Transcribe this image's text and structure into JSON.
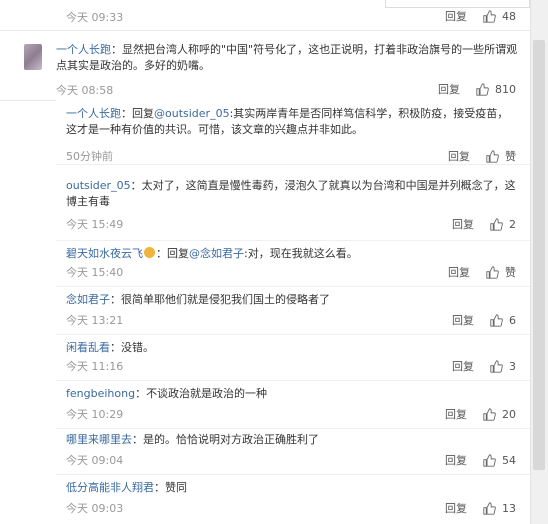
{
  "top_row": {
    "time": "今天 09:33",
    "reply": "回复",
    "likes": "48"
  },
  "main_comment": {
    "author": "一个人长跑",
    "separator": "：",
    "text": "显然把台湾人称呼的\"中国\"符号化了，这也正说明，打着非政治旗号的一些所谓观点其实是政治的。多好的奶嘴。",
    "time": "今天 08:58",
    "reply": "回复",
    "likes": "810"
  },
  "replies": [
    {
      "name": "一个人长跑",
      "prefix": "：回复",
      "mention": "@outsider_05",
      "text": ":其实两岸青年是否同样笃信科学，积极防疫，接受疫苗，这才是一种有价值的共识。可惜，该文章的兴趣点并非如此。",
      "time": "50分钟前",
      "reply": "回复",
      "likes": "赞"
    },
    {
      "name": "outsider_05",
      "prefix": "：",
      "mention": "",
      "text": "太对了，这简直是慢性毒药，浸泡久了就真以为台湾和中国是并列概念了，这博主有毒",
      "time": "今天 15:49",
      "reply": "回复",
      "likes": "2"
    },
    {
      "name": "碧天如水夜云飞",
      "prefix": "：回复",
      "mention": "@念如君子",
      "text": ":对，现在我就这么看。",
      "time": "今天 15:40",
      "reply": "回复",
      "likes": "赞"
    },
    {
      "name": "念如君子",
      "prefix": "：",
      "mention": "",
      "text": "很简单耶他们就是侵犯我们国土的侵略者了",
      "time": "今天 13:21",
      "reply": "回复",
      "likes": "6"
    },
    {
      "name": "闲看乱看",
      "prefix": "：",
      "mention": "",
      "text": "没错。",
      "time": "今天 11:16",
      "reply": "回复",
      "likes": "3"
    },
    {
      "name": "fengbeihong",
      "prefix": "：",
      "mention": "",
      "text": "不谈政治就是政治的一种",
      "time": "今天 10:29",
      "reply": "回复",
      "likes": "20"
    },
    {
      "name": "哪里来哪里去",
      "prefix": "：",
      "mention": "",
      "text": "是的。恰恰说明对方政治正确胜利了",
      "time": "今天 09:04",
      "reply": "回复",
      "likes": "54"
    },
    {
      "name": "低分高能非人翔君",
      "prefix": "：",
      "mention": "",
      "text": "赞同",
      "time": "今天 09:03",
      "reply": "回复",
      "likes": "13"
    }
  ],
  "colors": {
    "link": "#3a6aa0",
    "muted": "#999999",
    "text": "#333333",
    "separator": "#eaeaea"
  },
  "icons": {
    "like": "thumbs-up-icon",
    "emoji": "smiley-icon"
  }
}
